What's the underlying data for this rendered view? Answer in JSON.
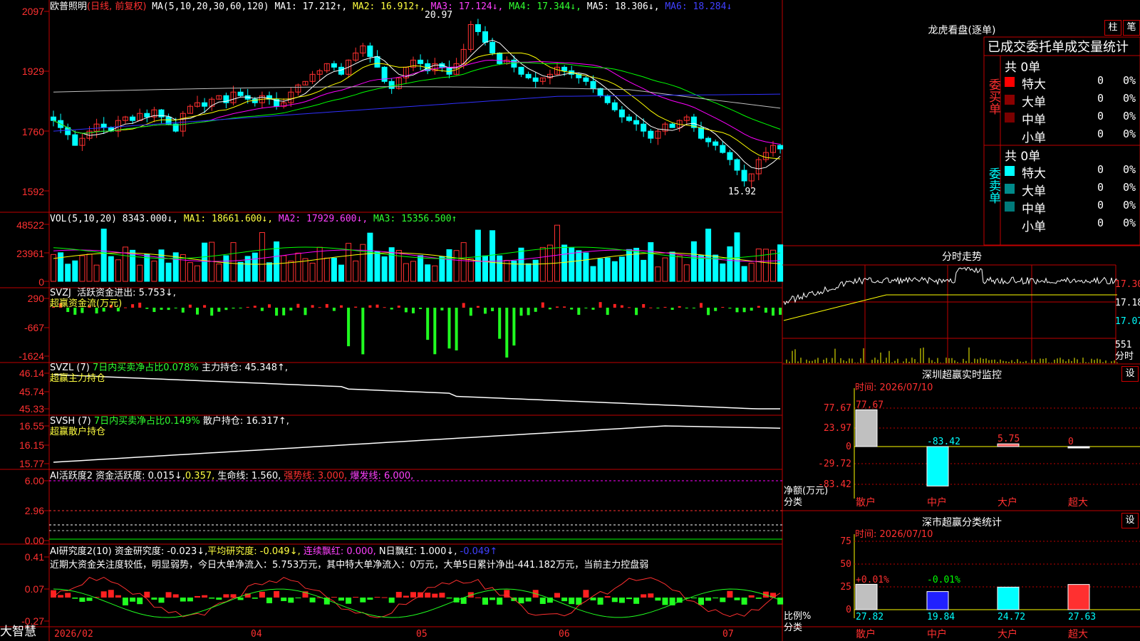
{
  "stock": {
    "name": "欧普照明",
    "mode": "(日线, 前复权)"
  },
  "ma": {
    "label": "MA(5,10,20,30,60,120)",
    "ma1": "MA1: 17.212↑,",
    "ma2": "MA2: 16.912↑,",
    "ma3": "MA3: 17.124↓,",
    "ma4": "MA4: 17.344↓,",
    "ma5": "MA5: 18.306↓,",
    "ma6": "MA6: 18.284↓"
  },
  "price_axis": [
    "2097",
    "1929",
    "1760",
    "1592"
  ],
  "price_marks": {
    "high": "20.97",
    "low": "15.92"
  },
  "vol": {
    "label": "VOL(5,10,20)",
    "value": "8343.000↓,",
    "ma1": "MA1: 18661.600↓,",
    "ma2": "MA2: 17929.600↓,",
    "ma3": "MA3: 15356.500↑",
    "axis": [
      "48522",
      "23961",
      "0"
    ]
  },
  "svzj": {
    "label": "SVZJ",
    "desc": "活跃资金进出: 5.753↓,",
    "sub": "超赢资金流(万元)",
    "axis": [
      "290",
      "-667",
      "-1624"
    ]
  },
  "svzl": {
    "label": "SVZL (7)",
    "desc": "7日内买卖净占比0.078%",
    "hold": "主力持仓: 45.348↑,",
    "sub": "超赢主力持仓",
    "axis": [
      "46.14",
      "45.74",
      "45.33"
    ]
  },
  "svsh": {
    "label": "SVSH (7)",
    "desc": "7日内买卖净占比0.149%",
    "hold": "散户持仓: 16.317↑,",
    "sub": "超赢散户持仓",
    "axis": [
      "16.55",
      "16.15",
      "15.77"
    ]
  },
  "ai1": {
    "label": "AI活跃度2",
    "a": "资金活跃度: 0.015↓,",
    "b": "0.357,",
    "c": "生命线: 1.560,",
    "d": "强势线: 3.000,",
    "e": "爆发线: 6.000,",
    "axis": [
      "6.00",
      "2.96",
      "0.00"
    ]
  },
  "ai2": {
    "label": "AI研究度2(10)",
    "a": "资金研究度: -0.023↓,",
    "b": "平均研究度: -0.049↓,",
    "c": "连续飘红: 0.000,",
    "d": "N日飘红: 1.000↓,",
    "e": "-0.049↑",
    "comment": "近期大资金关注度较低，明显弱势，今日大单净流入：5.753万元，其中特大单净流入：0万元，大单5日累计净出-441.182万元，当前主力控盘弱",
    "axis": [
      "0.41",
      "0.07",
      "-0.27"
    ]
  },
  "bottom": {
    "brand": "大智慧",
    "dates": [
      "2026/02",
      "04",
      "05",
      "06",
      "07"
    ]
  },
  "lhb": {
    "title": "龙虎看盘(逐单)",
    "btn1": "柱",
    "btn2": "笔",
    "head": "已成交委托单成交量统计",
    "buy": {
      "label": "委买单",
      "total": "共 0单",
      "rows": [
        {
          "name": "特大",
          "v": "0",
          "p": "0%"
        },
        {
          "name": "大单",
          "v": "0",
          "p": "0%"
        },
        {
          "name": "中单",
          "v": "0",
          "p": "0%"
        },
        {
          "name": "小单",
          "v": "0",
          "p": "0%"
        }
      ]
    },
    "sell": {
      "label": "委卖单",
      "total": "共 0单",
      "rows": [
        {
          "name": "特大",
          "v": "0",
          "p": "0%"
        },
        {
          "name": "大单",
          "v": "0",
          "p": "0%"
        },
        {
          "name": "中单",
          "v": "0",
          "p": "0%"
        },
        {
          "name": "小单",
          "v": "0",
          "p": "0%"
        }
      ]
    }
  },
  "fenshi": {
    "title": "分时走势",
    "axis": [
      "17.30",
      "17.18",
      "17.07"
    ],
    "vol": "551",
    "vol_unit": "分时"
  },
  "szmon": {
    "title": "深圳超赢实时监控",
    "btn": "设",
    "time": "时间: 2026/07/10",
    "axis": [
      "77.67",
      "23.97",
      "0",
      "-29.72",
      "-83.42"
    ],
    "ylabel": "净额(万元)",
    "xlabel": "分类",
    "vals": [
      "77.67",
      "-83.42",
      "5.75",
      "0"
    ],
    "cats": [
      "散户",
      "中户",
      "大户",
      "超大"
    ]
  },
  "szcls": {
    "title": "深市超赢分类统计",
    "btn": "设",
    "time": "时间: 2026/07/10",
    "axis": [
      "75",
      "50",
      "25",
      "0"
    ],
    "ylabel": "比例%",
    "xlabel": "分类",
    "top": [
      "+0.01%",
      "-0.01%"
    ],
    "vals": [
      "27.82",
      "19.84",
      "24.72",
      "27.63"
    ],
    "cats": [
      "散户",
      "中户",
      "大户",
      "超大"
    ]
  }
}
